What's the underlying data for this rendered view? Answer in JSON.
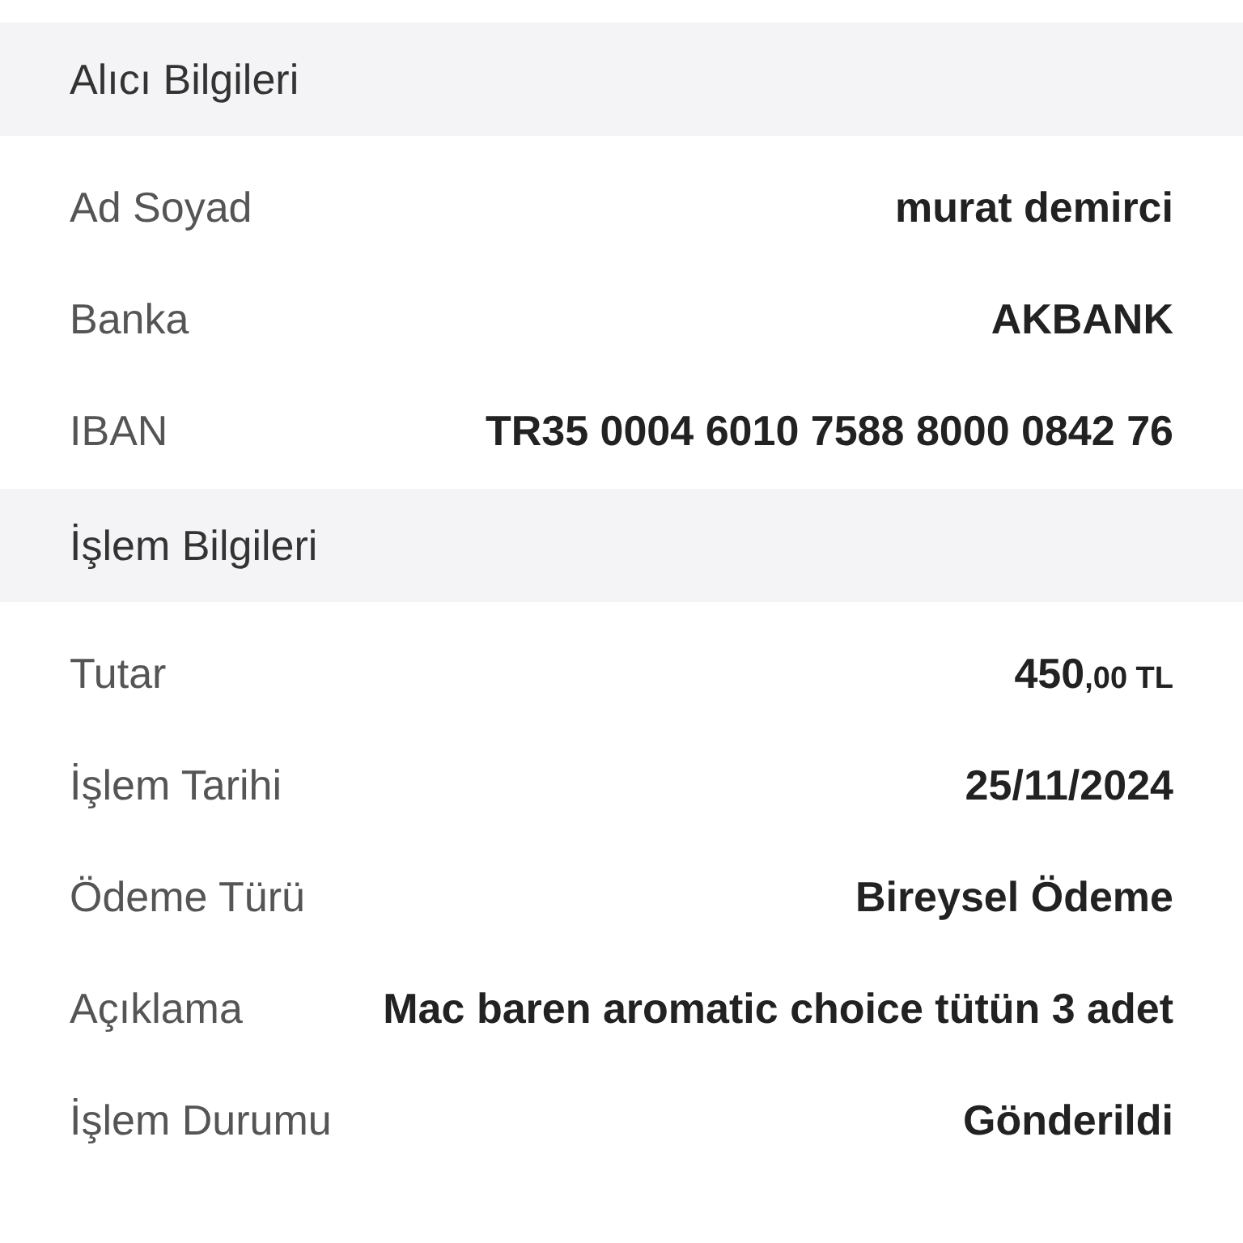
{
  "sections": [
    {
      "title": "Alıcı Bilgileri",
      "rows": [
        {
          "label": "Ad Soyad",
          "value": "murat demirci"
        },
        {
          "label": "Banka",
          "value": "AKBANK"
        },
        {
          "label": "IBAN",
          "value": "TR35 0004 6010 7588 8000 0842 76"
        }
      ]
    },
    {
      "title": "İşlem Bilgileri",
      "rows": [
        {
          "label": "Tutar",
          "value": "450",
          "fraction": ",00 TL"
        },
        {
          "label": "İşlem Tarihi",
          "value": "25/11/2024"
        },
        {
          "label": "Ödeme Türü",
          "value": "Bireysel Ödeme"
        },
        {
          "label": "Açıklama",
          "value": "Mac baren aromatic choice tütün 3 adet"
        },
        {
          "label": "İşlem Durumu",
          "value": "Gönderildi"
        }
      ]
    }
  ]
}
